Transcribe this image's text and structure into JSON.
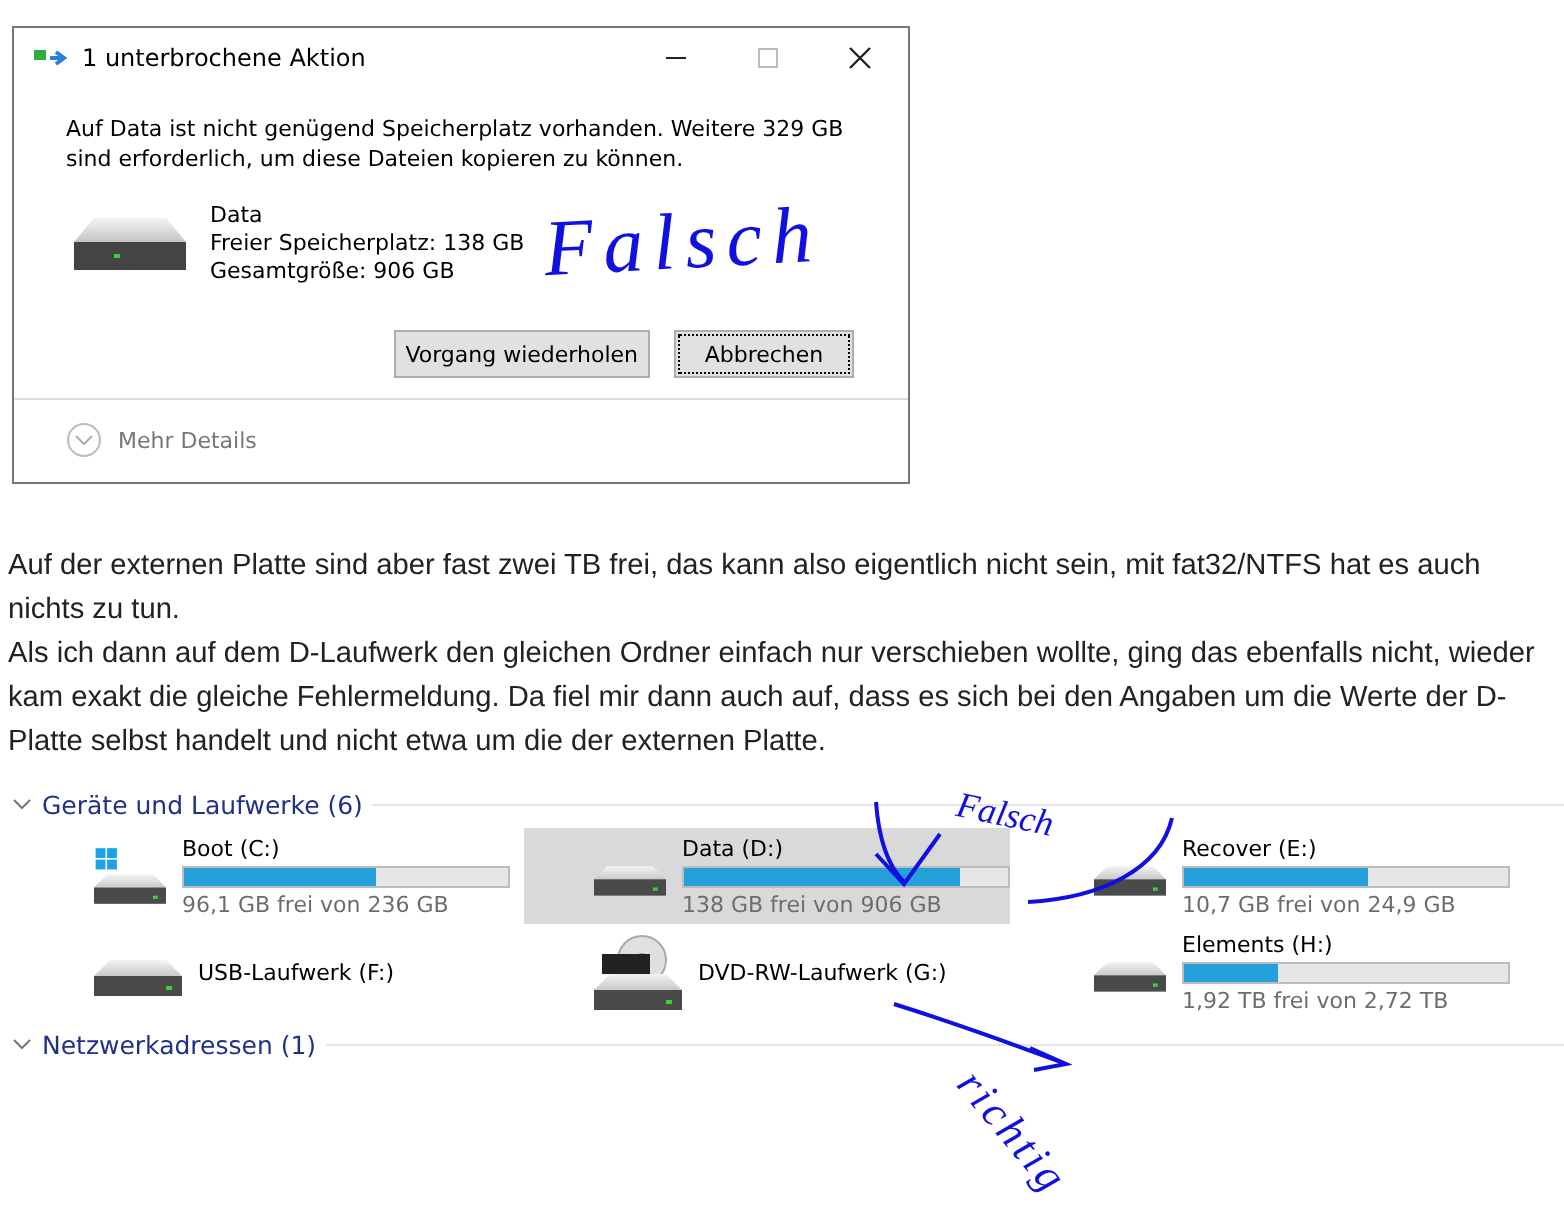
{
  "dialog": {
    "title": "1 unterbrochene Aktion",
    "message": "Auf Data ist nicht genügend Speicherplatz vorhanden. Weitere 329 GB sind erforderlich, um diese Dateien kopieren zu können.",
    "drive": {
      "name": "Data",
      "free": "Freier Speicherplatz: 138 GB",
      "total": "Gesamtgröße: 906 GB"
    },
    "buttons": [
      {
        "label": "Vorgang wiederholen",
        "focused": false
      },
      {
        "label": "Abbrechen",
        "focused": true
      }
    ],
    "details": "Mehr Details"
  },
  "post": [
    "Auf der externen Platte sind aber fast zwei TB frei, das kann also eigentlich nicht sein, mit fat32/NTFS hat es auch nichts zu tun.",
    "Als ich dann auf dem D-Laufwerk den gleichen Ordner einfach nur verschieben wollte, ging das ebenfalls nicht, wieder kam exakt die gleiche Fehlermeldung. Da fiel mir dann auch auf, dass es sich bei den Angaben um die Werte der D-Platte selbst handelt und nicht etwa um die der externen Platte."
  ],
  "explorer": {
    "group": "Geräte und Laufwerke (6)",
    "drives": [
      {
        "kind": "system",
        "name": "Boot (C:)",
        "level": 0.59,
        "info": "96,1 GB frei von 236 GB",
        "selected": false
      },
      {
        "kind": "disk",
        "name": "Data (D:)",
        "level": 0.85,
        "info": "138 GB frei von 906 GB",
        "selected": true
      },
      {
        "kind": "disk",
        "name": "Recover (E:)",
        "level": 0.57,
        "info": "10,7 GB frei von 24,9 GB",
        "selected": false
      },
      {
        "kind": "disk",
        "name": "USB-Laufwerk (F:)",
        "selected": false
      },
      {
        "kind": "dvd",
        "name": "DVD-RW-Laufwerk (G:)",
        "selected": false
      },
      {
        "kind": "disk",
        "name": "Elements (H:)",
        "level": 0.29,
        "info": "1,92 TB frei von 2,72 TB",
        "selected": false
      }
    ],
    "group2": "Netzwerkadressen (1)"
  },
  "annotations": [
    "Falsch",
    "Falsch",
    "richtig"
  ]
}
